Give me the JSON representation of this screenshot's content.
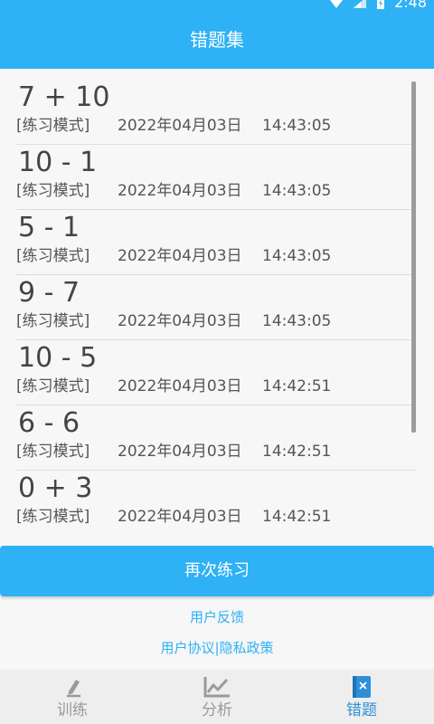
{
  "status_bar": {
    "time": "2:48",
    "icons": [
      "wifi-icon",
      "signal-icon",
      "battery-icon"
    ]
  },
  "header": {
    "title": "错题集"
  },
  "mistakes": [
    {
      "expression": "7 + 10",
      "mode": "[练习模式]",
      "date": "2022年04月03日",
      "time": "14:43:05"
    },
    {
      "expression": "10 - 1",
      "mode": "[练习模式]",
      "date": "2022年04月03日",
      "time": "14:43:05"
    },
    {
      "expression": "5 - 1",
      "mode": "[练习模式]",
      "date": "2022年04月03日",
      "time": "14:43:05"
    },
    {
      "expression": "9 - 7",
      "mode": "[练习模式]",
      "date": "2022年04月03日",
      "time": "14:43:05"
    },
    {
      "expression": "10 - 5",
      "mode": "[练习模式]",
      "date": "2022年04月03日",
      "time": "14:42:51"
    },
    {
      "expression": "6 - 6",
      "mode": "[练习模式]",
      "date": "2022年04月03日",
      "time": "14:42:51"
    },
    {
      "expression": "0 + 3",
      "mode": "[练习模式]",
      "date": "2022年04月03日",
      "time": "14:42:51"
    }
  ],
  "actions": {
    "retry_label": "再次练习"
  },
  "footer": {
    "feedback_label": "用户反馈",
    "agreement_label": "用户协议",
    "separator": "|",
    "privacy_label": "隐私政策"
  },
  "bottom_nav": [
    {
      "label": "训练",
      "icon": "pencil-icon",
      "active": false
    },
    {
      "label": "分析",
      "icon": "line-chart-icon",
      "active": false
    },
    {
      "label": "错题",
      "icon": "wrong-book-icon",
      "active": true
    }
  ],
  "colors": {
    "primary": "#2eb1f5",
    "active_nav": "#2e8fd8",
    "inactive_nav": "#9a9a9a",
    "background": "#f7f7f7"
  }
}
